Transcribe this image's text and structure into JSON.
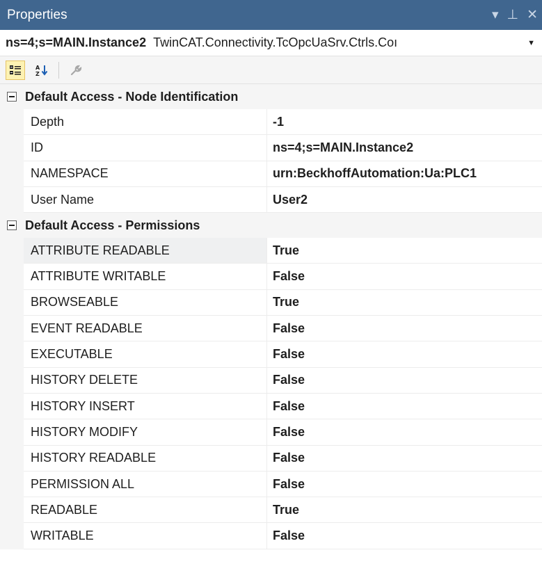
{
  "panel": {
    "title": "Properties",
    "dropdown_glyph": "▾",
    "pin_glyph": "⊥",
    "close_glyph": "✕"
  },
  "object": {
    "name": "ns=4;s=MAIN.Instance2",
    "type": "TwinCAT.Connectivity.TcOpcUaSrv.Ctrls.Coı"
  },
  "toolbar": {
    "categorized_icon": "categorized-icon",
    "alphabetical_icon": "alphabetical-icon",
    "property_pages_icon": "wrench-icon"
  },
  "categories": [
    {
      "label": "Default Access - Node Identification",
      "rows": [
        {
          "name": "Depth",
          "value": "-1"
        },
        {
          "name": "ID",
          "value": "ns=4;s=MAIN.Instance2"
        },
        {
          "name": "NAMESPACE",
          "value": "urn:BeckhoffAutomation:Ua:PLC1"
        },
        {
          "name": "User Name",
          "value": "User2"
        }
      ]
    },
    {
      "label": "Default Access - Permissions",
      "rows": [
        {
          "name": "ATTRIBUTE READABLE",
          "value": "True"
        },
        {
          "name": "ATTRIBUTE WRITABLE",
          "value": "False"
        },
        {
          "name": "BROWSEABLE",
          "value": "True"
        },
        {
          "name": "EVENT READABLE",
          "value": "False"
        },
        {
          "name": "EXECUTABLE",
          "value": "False"
        },
        {
          "name": "HISTORY DELETE",
          "value": "False"
        },
        {
          "name": "HISTORY INSERT",
          "value": "False"
        },
        {
          "name": "HISTORY MODIFY",
          "value": "False"
        },
        {
          "name": "HISTORY READABLE",
          "value": "False"
        },
        {
          "name": "PERMISSION ALL",
          "value": "False"
        },
        {
          "name": "READABLE",
          "value": "True"
        },
        {
          "name": "WRITABLE",
          "value": "False"
        }
      ]
    }
  ],
  "colors": {
    "titlebar": "#40668f",
    "category_bg": "#f5f5f5",
    "selected_toolbar_btn": "#fdf2b3"
  }
}
